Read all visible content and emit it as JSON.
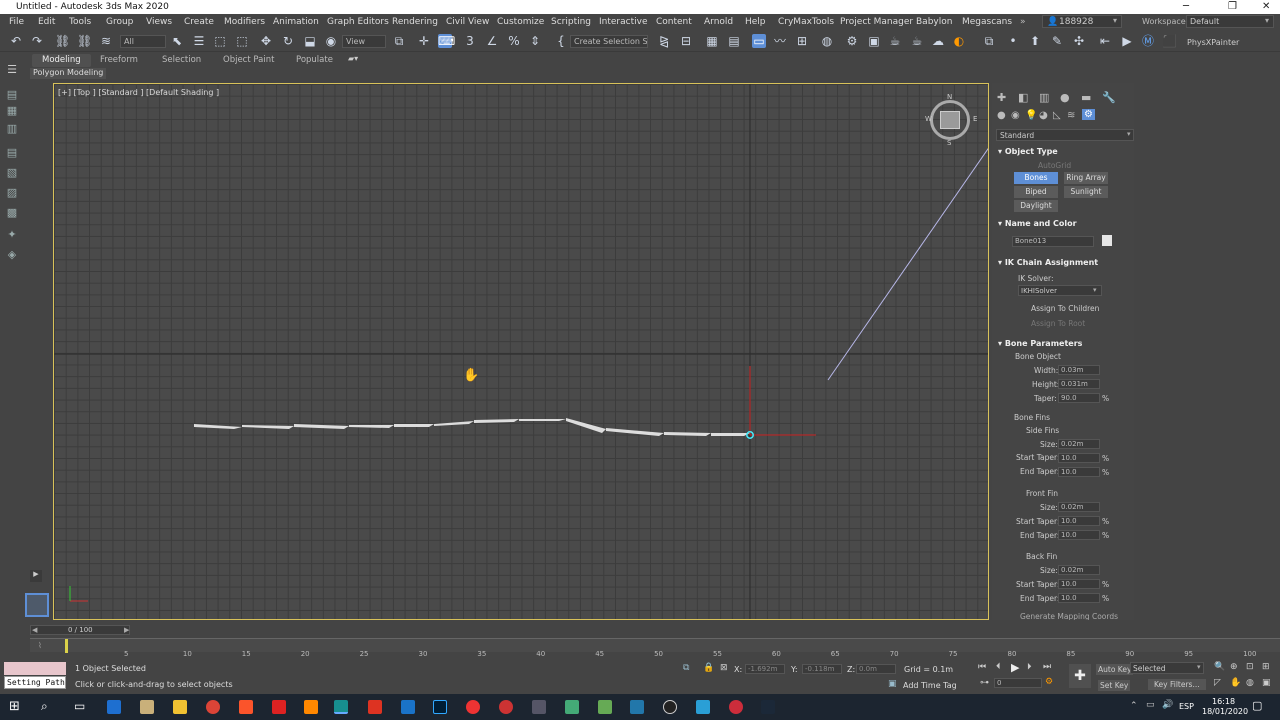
{
  "window": {
    "title": "Untitled - Autodesk 3ds Max 2020"
  },
  "menu": [
    "File",
    "Edit",
    "Tools",
    "Group",
    "Views",
    "Create",
    "Modifiers",
    "Animation",
    "Graph Editors",
    "Rendering",
    "Civil View",
    "Customize",
    "Scripting",
    "Interactive",
    "Content",
    "Arnold",
    "Help",
    "CryMaxTools",
    "Project Manager",
    "Babylon",
    "Megascans"
  ],
  "user": {
    "name": "188928"
  },
  "workspace": {
    "label": "Workspaces:",
    "value": "Default"
  },
  "toolbar": {
    "filter": "All",
    "refcoord": "View",
    "selset": "Create Selection Se",
    "plugin": "PhysXPainter"
  },
  "ribbon": {
    "tabs": [
      "Modeling",
      "Freeform",
      "Selection",
      "Object Paint",
      "Populate"
    ],
    "sub": "Polygon Modeling"
  },
  "viewport": {
    "label": "[+] [Top ] [Standard ] [Default Shading ]"
  },
  "viewcube": {
    "top": "N",
    "left": "W",
    "right": "E",
    "bottom": "S"
  },
  "command_panel": {
    "dropdown": "Standard",
    "object_type": {
      "title": "Object Type",
      "autogrid": "AutoGrid",
      "buttons": [
        "Bones",
        "Ring Array",
        "Biped",
        "Sunlight",
        "Daylight"
      ]
    },
    "name_color": {
      "title": "Name and Color",
      "name": "Bone013"
    },
    "ik": {
      "title": "IK Chain Assignment",
      "solver_label": "IK Solver:",
      "solver": "IKHISolver",
      "assign_children": "Assign To Children",
      "assign_root": "Assign To Root"
    },
    "bone_params": {
      "title": "Bone Parameters",
      "bone_object": "Bone Object",
      "width_label": "Width:",
      "width": "0.03m",
      "height_label": "Height:",
      "height": "0.031m",
      "taper_label": "Taper:",
      "taper": "90.0",
      "fins": "Bone Fins",
      "side_fins": "Side Fins",
      "front_fin": "Front Fin",
      "back_fin": "Back Fin",
      "size_label": "Size:",
      "size": "0.02m",
      "start_taper_label": "Start Taper:",
      "end_taper_label": "End Taper:",
      "taper_val": "10.0",
      "pct": "%",
      "next": "Generate Mapping Coords"
    }
  },
  "timeline": {
    "frame": "0 / 100",
    "ticks": [
      "5",
      "10",
      "15",
      "20",
      "25",
      "30",
      "35",
      "40",
      "45",
      "50",
      "55",
      "60",
      "65",
      "70",
      "75",
      "80",
      "85",
      "90",
      "95",
      "100"
    ]
  },
  "status": {
    "script_label": "Setting Path",
    "selected": "1 Object Selected",
    "prompt": "Click or click-and-drag to select objects",
    "x_label": "X:",
    "x": "-1.692m",
    "y_label": "Y:",
    "y": "-0.118m",
    "z_label": "Z:",
    "z": "0.0m",
    "grid": "Grid = 0.1m",
    "add_time_tag": "Add Time Tag",
    "autokey": "Auto Key",
    "setkey": "Set Key",
    "selected_mode": "Selected",
    "key_filters": "Key Filters...",
    "frame_field": "0"
  },
  "tray": {
    "lang": "ESP",
    "time": "16:18",
    "date": "18/01/2020"
  }
}
